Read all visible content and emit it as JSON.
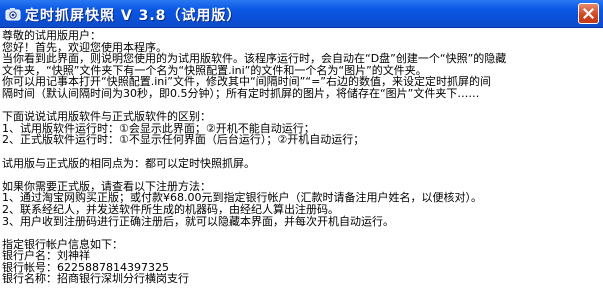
{
  "window": {
    "title": "定时抓屏快照 V 3.8（试用版）",
    "icon": "camera-icon",
    "close_icon": "close-icon",
    "accent": "#0b58e4",
    "close_color": "#d1441d"
  },
  "content": {
    "lines": [
      "尊敬的试用版用户：",
      "    您好！首先，欢迎您使用本程序。",
      "    当你看到此界面，则说明您使用的为试用版软件。该程序运行时，会自动在“D盘”创建一个“快照”的隐藏",
      "文件夹，“快照”文件夹下有一个名为“快照配置.ini”的文件和一个名为“图片”的文件夹。",
      "    你可以用记事本打开“快照配置.ini”文件，修改其中“间隔时间”“=”右边的数值，来设定定时抓屏的间",
      "隔时间（默认间隔时间为30秒，即0.5分钟）；所有定时抓屏的图片，将储存在“图片”文件夹下……",
      "",
      "    下面说说试用版软件与正式版软件的区别：",
      "    1、试用版软件运行时：①会显示此界面；②开机不能自动运行；",
      "    2、正式版软件运行时：①不显示任何界面（后台运行）；②开机自动运行；",
      "",
      "    试用版与正式版的相同点为：都可以定时快照抓屏。",
      "",
      "    如果你需要正式版，请查看以下注册方法：",
      "    1、通过淘宝网购买正版；或付款¥68.00元到指定银行帐户（汇款时请备注用户姓名，以便核对）。",
      "    2、联系经纪人，并发送软件所生成的机器码，由经纪人算出注册码。",
      "    3、用户收到注册码进行正确注册后，就可以隐藏本界面，并每次开机自动运行。",
      "",
      "    指定银行帐户信息如下：",
      "      银行户名：刘神祥",
      "      银行帐号：6225887814397325",
      "      银行名称：招商银行深圳分行横岗支行"
    ]
  }
}
